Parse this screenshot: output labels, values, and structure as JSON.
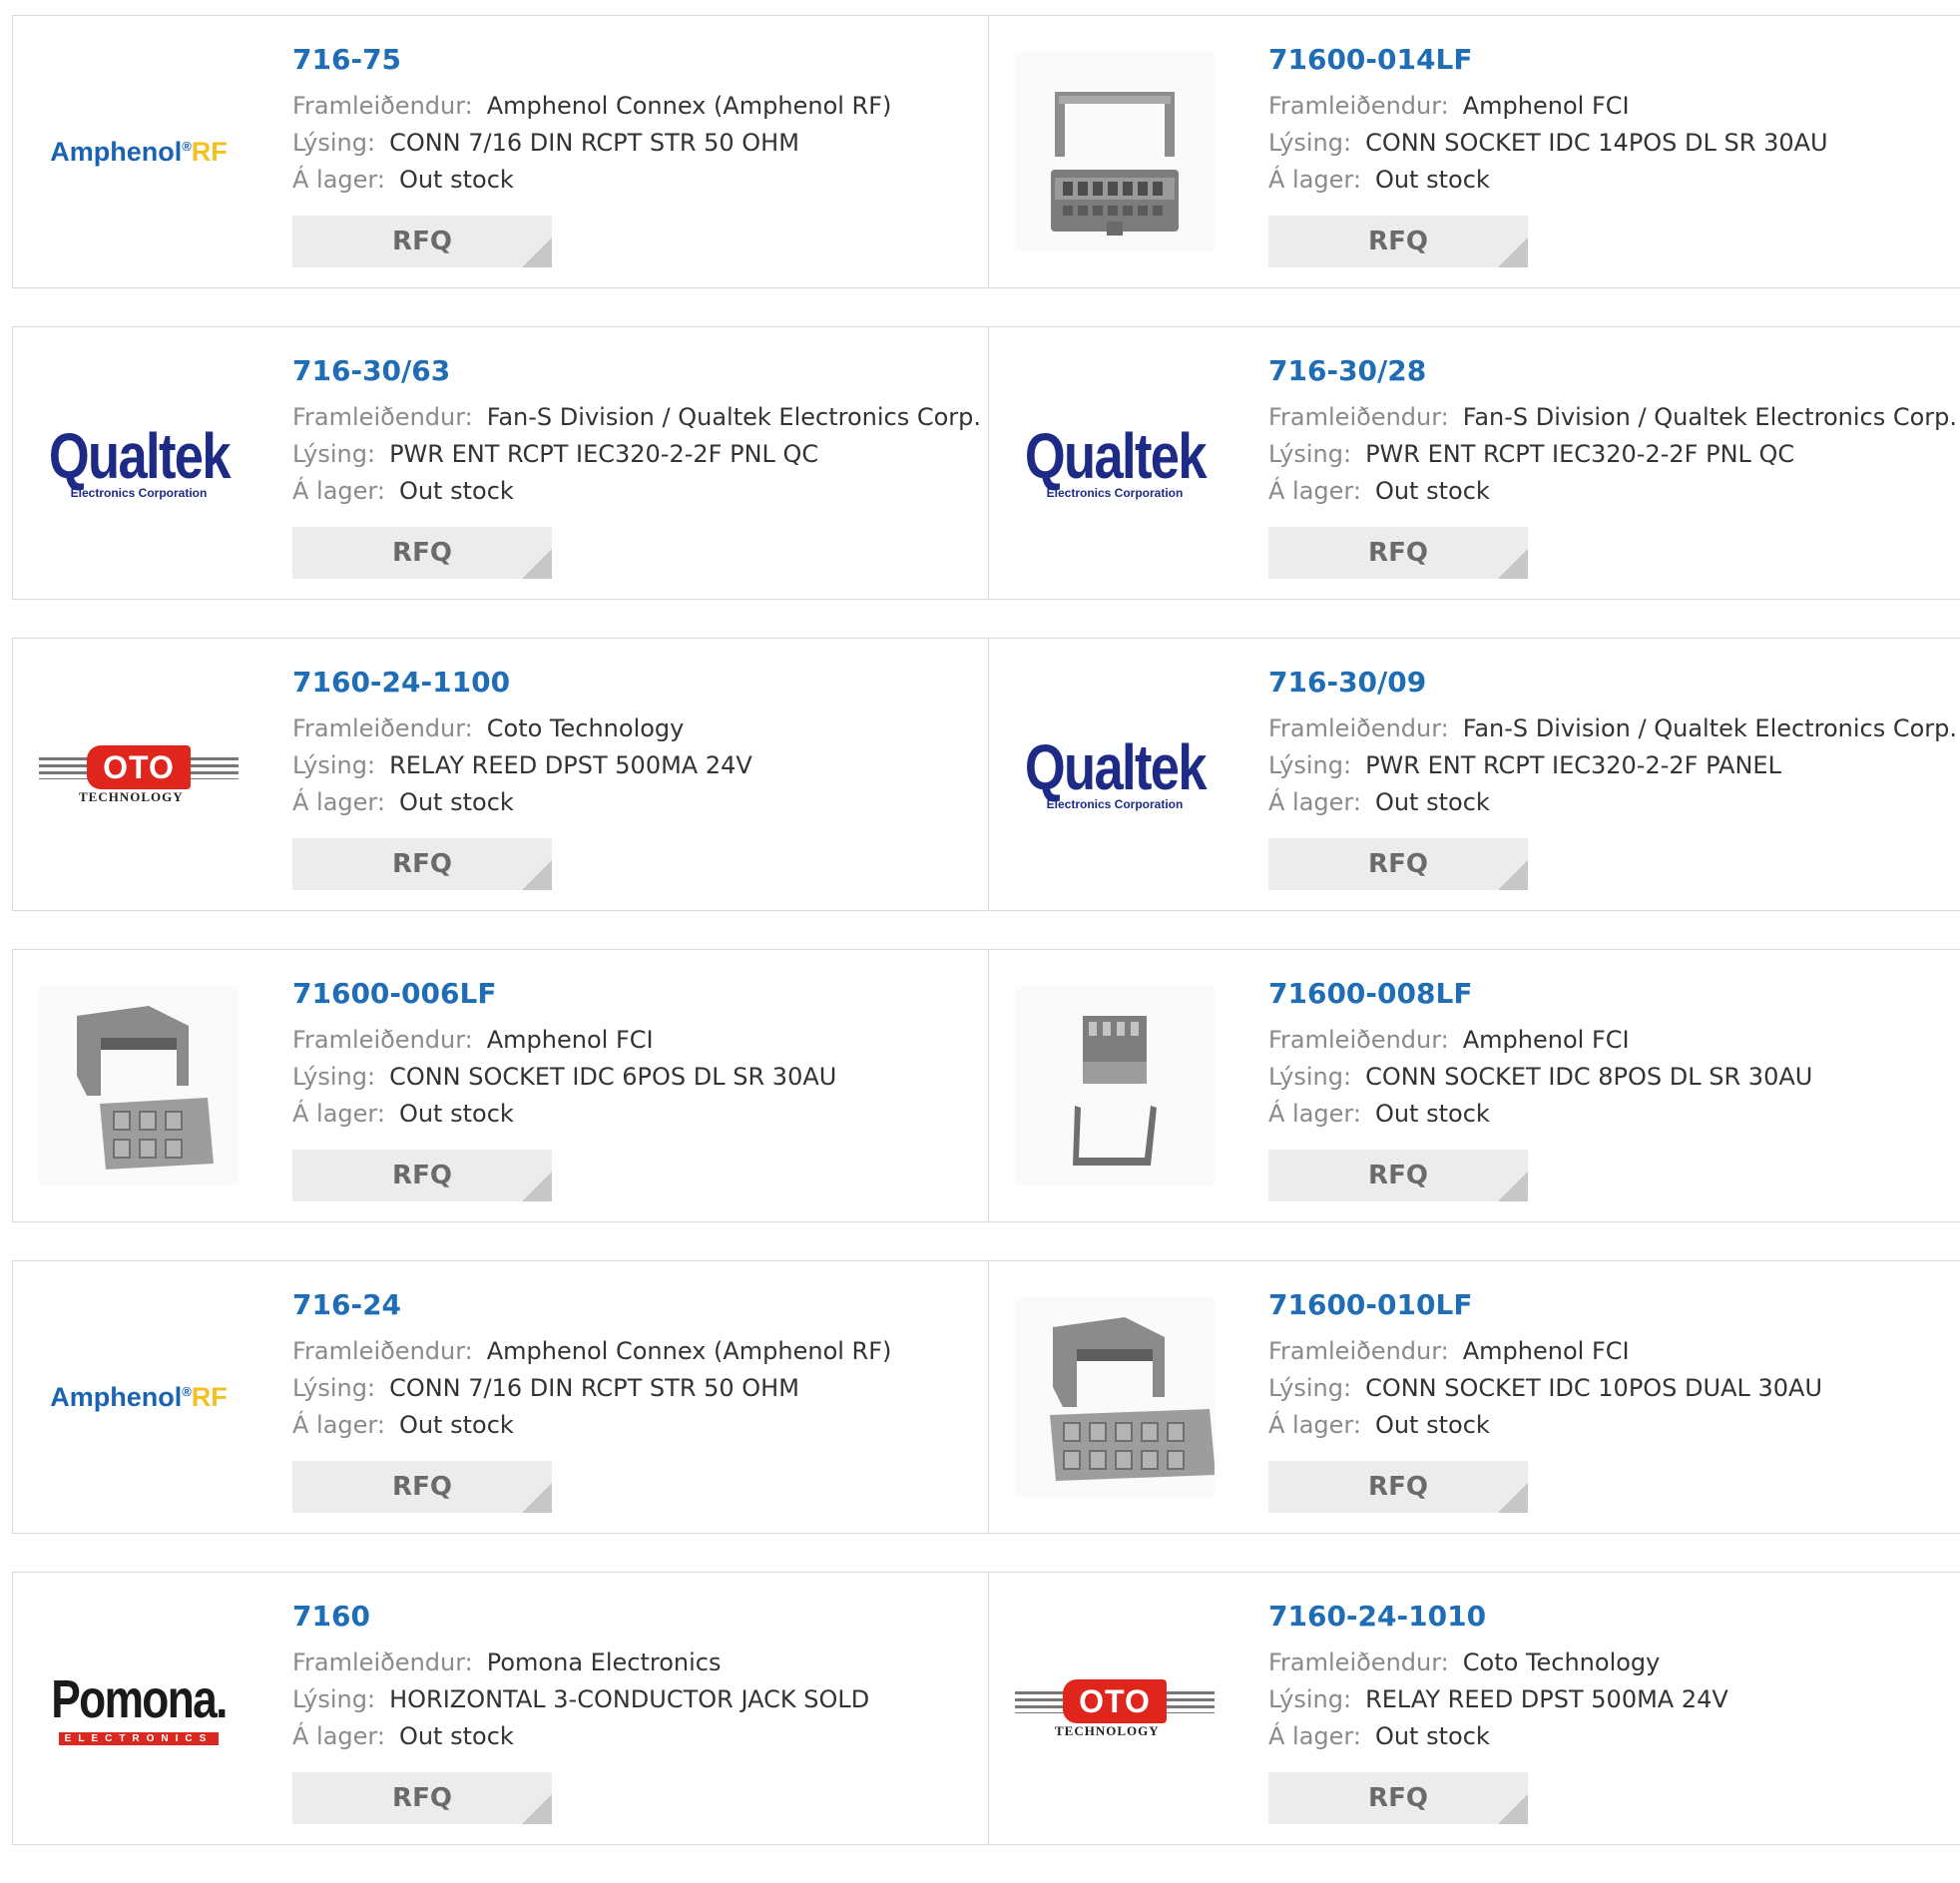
{
  "products": [
    {
      "part": "716-75",
      "manufacturer": "Amphenol Connex (Amphenol RF)",
      "description": "CONN 7/16 DIN RCPT STR 50 OHM",
      "stock": "Out stock",
      "logo": "amphenol-rf",
      "logo_text": {
        "main": "Amphenol",
        "sup": "®",
        "rf": "RF"
      }
    },
    {
      "part": "71600-014LF",
      "manufacturer": "Amphenol FCI",
      "description": "CONN SOCKET IDC 14POS DL SR 30AU",
      "stock": "Out stock",
      "logo": "photo-idc-14"
    },
    {
      "part": "716-30/63",
      "manufacturer": "Fan-S Division / Qualtek Electronics Corp.",
      "description": "PWR ENT RCPT IEC320-2-2F PNL QC",
      "stock": "Out stock",
      "logo": "qualtek",
      "logo_text": {
        "main": "Qualtek",
        "sub": "Electronics Corporation"
      }
    },
    {
      "part": "716-30/28",
      "manufacturer": "Fan-S Division / Qualtek Electronics Corp.",
      "description": "PWR ENT RCPT IEC320-2-2F PNL QC",
      "stock": "Out stock",
      "logo": "qualtek",
      "logo_text": {
        "main": "Qualtek",
        "sub": "Electronics Corporation"
      }
    },
    {
      "part": "7160-24-1100",
      "manufacturer": "Coto Technology",
      "description": "RELAY REED DPST 500MA 24V",
      "stock": "Out stock",
      "logo": "coto",
      "logo_text": {
        "main": "OTO",
        "sub": "TECHNOLOGY"
      }
    },
    {
      "part": "716-30/09",
      "manufacturer": "Fan-S Division / Qualtek Electronics Corp.",
      "description": "PWR ENT RCPT IEC320-2-2F PANEL",
      "stock": "Out stock",
      "logo": "qualtek",
      "logo_text": {
        "main": "Qualtek",
        "sub": "Electronics Corporation"
      }
    },
    {
      "part": "71600-006LF",
      "manufacturer": "Amphenol FCI",
      "description": "CONN SOCKET IDC 6POS DL SR 30AU",
      "stock": "Out stock",
      "logo": "photo-idc-6"
    },
    {
      "part": "71600-008LF",
      "manufacturer": "Amphenol FCI",
      "description": "CONN SOCKET IDC 8POS DL SR 30AU",
      "stock": "Out stock",
      "logo": "photo-idc-8"
    },
    {
      "part": "716-24",
      "manufacturer": "Amphenol Connex (Amphenol RF)",
      "description": "CONN 7/16 DIN RCPT STR 50 OHM",
      "stock": "Out stock",
      "logo": "amphenol-rf",
      "logo_text": {
        "main": "Amphenol",
        "sup": "®",
        "rf": "RF"
      }
    },
    {
      "part": "71600-010LF",
      "manufacturer": "Amphenol FCI",
      "description": "CONN SOCKET IDC 10POS DUAL 30AU",
      "stock": "Out stock",
      "logo": "photo-idc-10"
    },
    {
      "part": "7160",
      "manufacturer": "Pomona Electronics",
      "description": "HORIZONTAL 3-CONDUCTOR JACK SOLD",
      "stock": "Out stock",
      "logo": "pomona",
      "logo_text": {
        "main": "Pomona.",
        "sub": "ELECTRONICS"
      }
    },
    {
      "part": "7160-24-1010",
      "manufacturer": "Coto Technology",
      "description": "RELAY REED DPST 500MA 24V",
      "stock": "Out stock",
      "logo": "coto",
      "logo_text": {
        "main": "OTO",
        "sub": "TECHNOLOGY"
      }
    }
  ],
  "labels": {
    "manufacturer": "Framleiðendur:",
    "description": "Lýsing:",
    "stock": "Á lager:",
    "rfq": "RFQ"
  },
  "colors": {
    "part_link": "#1f6db5",
    "label": "#8a8a8a",
    "value": "#333333",
    "rfq_bg": "#ececec",
    "border": "#d9d9d9"
  }
}
